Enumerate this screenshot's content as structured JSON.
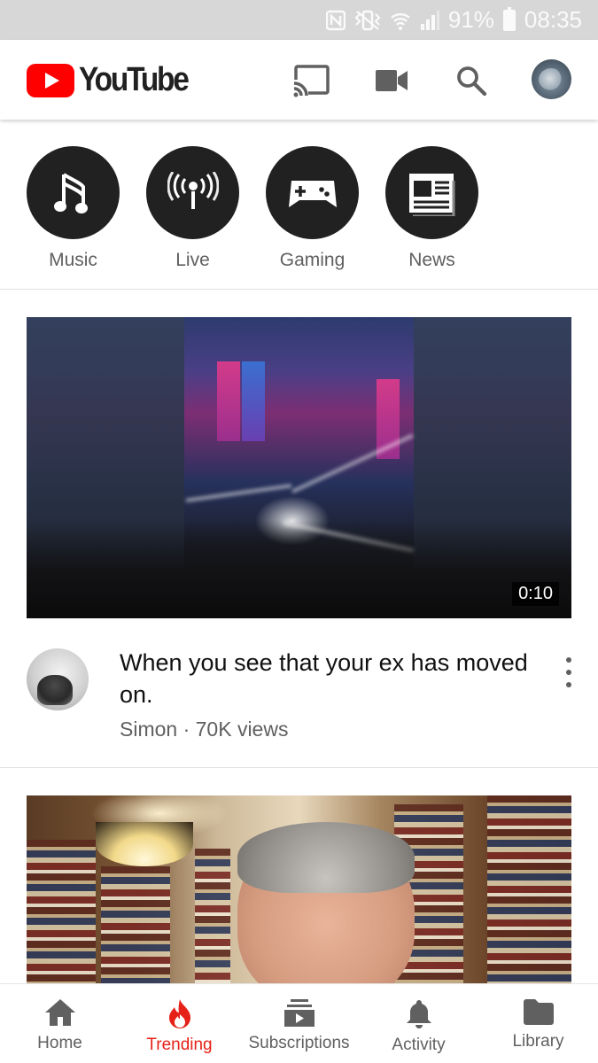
{
  "status_bar": {
    "battery": "91%",
    "time": "08:35",
    "icons": [
      "nfc-icon",
      "vibrate-icon",
      "wifi-icon",
      "signal-icon",
      "battery-icon"
    ]
  },
  "app_bar": {
    "logo_text": "YouTube",
    "brand_color": "#ff0000",
    "actions": [
      "cast-icon",
      "camera-icon",
      "search-icon",
      "account-avatar"
    ]
  },
  "categories": [
    {
      "label": "Music",
      "icon": "music-note-icon"
    },
    {
      "label": "Live",
      "icon": "live-broadcast-icon"
    },
    {
      "label": "Gaming",
      "icon": "gamepad-icon"
    },
    {
      "label": "News",
      "icon": "newspaper-icon"
    }
  ],
  "feed": [
    {
      "duration": "0:10",
      "title": "When you see that your ex has moved on.",
      "channel": "Simon",
      "views": "70K views",
      "byline": "Simon · 70K views"
    },
    {
      "duration": "",
      "title": "",
      "byline": ""
    }
  ],
  "bottom_nav": {
    "active_color": "#e62117",
    "items": [
      {
        "label": "Home",
        "icon": "home-icon",
        "active": false
      },
      {
        "label": "Trending",
        "icon": "trending-flame-icon",
        "active": true
      },
      {
        "label": "Subscriptions",
        "icon": "subscriptions-icon",
        "active": false
      },
      {
        "label": "Activity",
        "icon": "bell-icon",
        "active": false
      },
      {
        "label": "Library",
        "icon": "folder-icon",
        "active": false
      }
    ]
  }
}
